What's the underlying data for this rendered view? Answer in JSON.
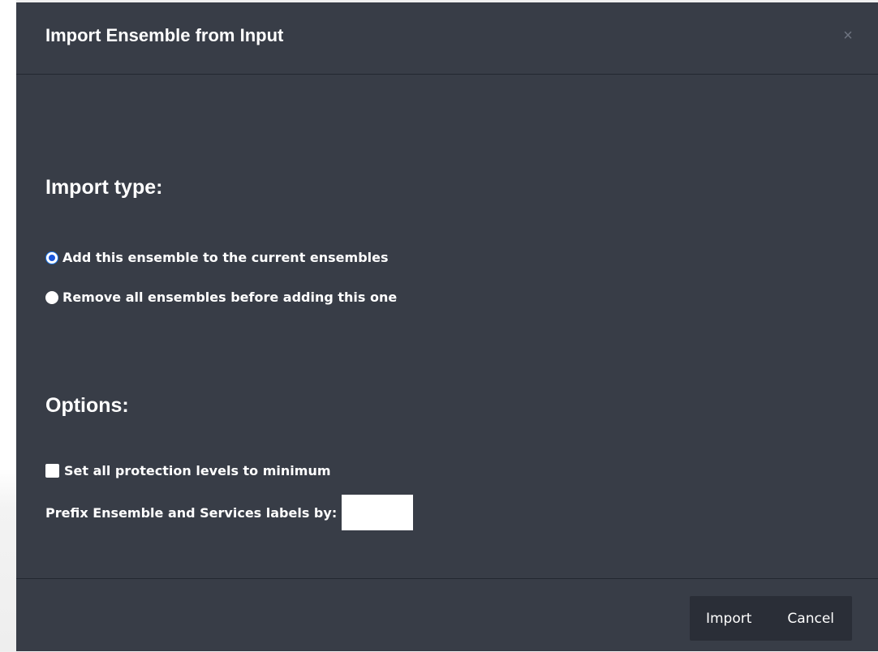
{
  "dialog": {
    "title": "Import Ensemble from Input",
    "close_glyph": "×",
    "import_type": {
      "heading": "Import type:",
      "options": [
        {
          "label": "Add this ensemble to the current ensembles",
          "checked": true
        },
        {
          "label": "Remove all ensembles before adding this one",
          "checked": false
        }
      ]
    },
    "options_section": {
      "heading": "Options:",
      "protection_checkbox": {
        "label": "Set all protection levels to minimum",
        "checked": false
      },
      "prefix_field": {
        "label": "Prefix Ensemble and Services labels by:",
        "value": ""
      }
    },
    "buttons": {
      "import_label": "Import",
      "cancel_label": "Cancel"
    }
  },
  "colors": {
    "modal_bg": "#383d47",
    "button_bg": "#2a2e37",
    "radio_accent": "#1a56db",
    "text": "#ffffff"
  }
}
